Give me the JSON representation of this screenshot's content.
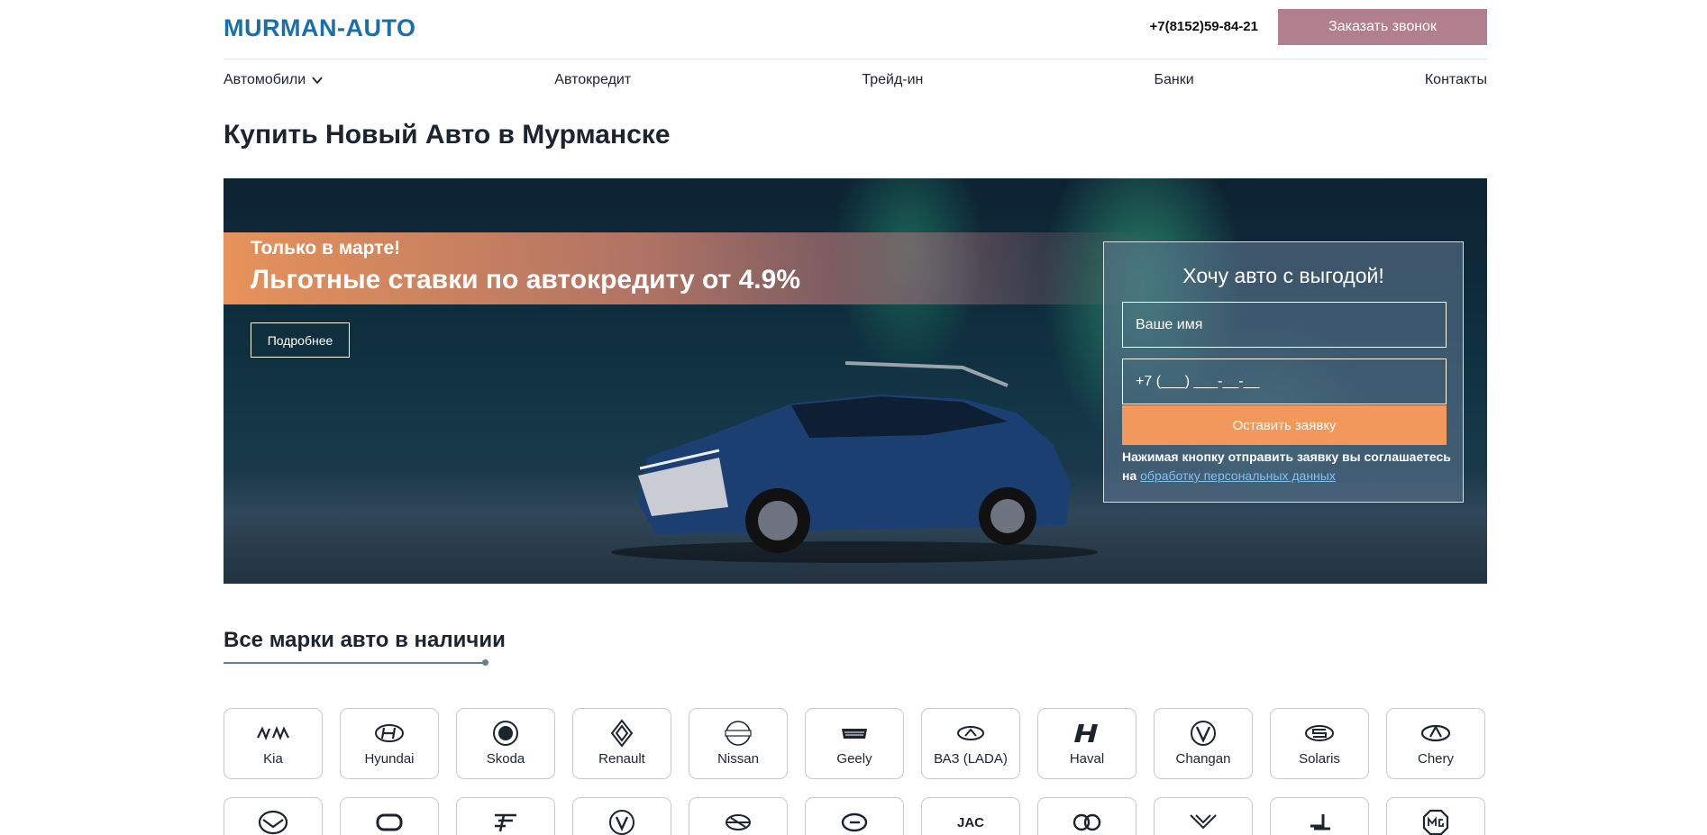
{
  "header": {
    "logo": "MURMAN-AUTO",
    "phone": "+7(8152)59-84-21",
    "callback_label": "Заказать звонок"
  },
  "nav": {
    "items": [
      {
        "label": "Автомобили"
      },
      {
        "label": "Автокредит"
      },
      {
        "label": "Трейд-ин"
      },
      {
        "label": "Банки"
      },
      {
        "label": "Контакты"
      }
    ]
  },
  "page_title": "Купить Новый Авто в Мурманске",
  "hero": {
    "promo_sub": "Только в марте!",
    "promo_main": "Льготные ставки по автокредиту от 4.9%",
    "more_label": "Подробнее",
    "form": {
      "title": "Хочу авто с выгодой!",
      "name_placeholder": "Ваше имя",
      "phone_placeholder": "+7 (___) ___-__-__",
      "submit_label": "Оставить заявку",
      "consent_text": "Нажимая кнопку отправить заявку вы соглашаетесь на",
      "consent_link": "обработку персональных данных"
    }
  },
  "brands": {
    "title": "Все марки авто в наличии",
    "row1": [
      {
        "label": "Kia",
        "icon": "kia-logo-icon"
      },
      {
        "label": "Hyundai",
        "icon": "hyundai-logo-icon"
      },
      {
        "label": "Skoda",
        "icon": "skoda-logo-icon"
      },
      {
        "label": "Renault",
        "icon": "renault-logo-icon"
      },
      {
        "label": "Nissan",
        "icon": "nissan-logo-icon"
      },
      {
        "label": "Geely",
        "icon": "geely-logo-icon"
      },
      {
        "label": "ВАЗ (LADA)",
        "icon": "lada-logo-icon"
      },
      {
        "label": "Haval",
        "icon": "haval-logo-icon"
      },
      {
        "label": "Changan",
        "icon": "changan-logo-icon"
      },
      {
        "label": "Solaris",
        "icon": "solaris-logo-icon"
      },
      {
        "label": "Chery",
        "icon": "chery-logo-icon"
      }
    ],
    "row2": [
      {
        "icon": "mazda-logo-icon"
      },
      {
        "icon": "brand-logo-icon"
      },
      {
        "icon": "brand-logo-icon"
      },
      {
        "icon": "dongfeng-logo-icon"
      },
      {
        "icon": "brand-logo-icon"
      },
      {
        "icon": "brand-logo-icon"
      },
      {
        "icon": "jac-logo-icon",
        "text": "JAC"
      },
      {
        "icon": "brand-logo-icon"
      },
      {
        "icon": "brand-logo-icon"
      },
      {
        "icon": "brand-logo-icon"
      },
      {
        "icon": "mg-logo-icon"
      }
    ]
  },
  "colors": {
    "logo": "#1b6fa8",
    "callback_bg": "#b17f8d",
    "accent_orange": "#f2985c",
    "text": "#1d2430"
  }
}
